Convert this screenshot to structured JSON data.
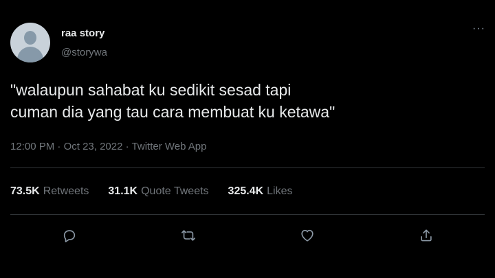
{
  "user": {
    "display_name": "raa story",
    "handle": "@storywa"
  },
  "more_label": "···",
  "tweet": {
    "text_line1": "\"walaupun sahabat ku sedikit sesad tapi",
    "text_line2": "cuman dia yang tau cara membuat ku ketawa\""
  },
  "meta": {
    "time": "12:00 PM",
    "separator": " · ",
    "date": "Oct 23, 2022",
    "source": "Twitter Web App"
  },
  "stats": {
    "retweets_count": "73.5K",
    "retweets_label": "Retweets",
    "quotes_count": "31.1K",
    "quotes_label": "Quote Tweets",
    "likes_count": "325.4K",
    "likes_label": "Likes"
  },
  "icons": {
    "reply": "reply-icon",
    "retweet": "retweet-icon",
    "like": "like-icon",
    "share": "share-icon"
  },
  "colors": {
    "background": "#000000",
    "text_primary": "#e7e9ea",
    "text_secondary": "#71767b",
    "divider": "#2f3336"
  }
}
